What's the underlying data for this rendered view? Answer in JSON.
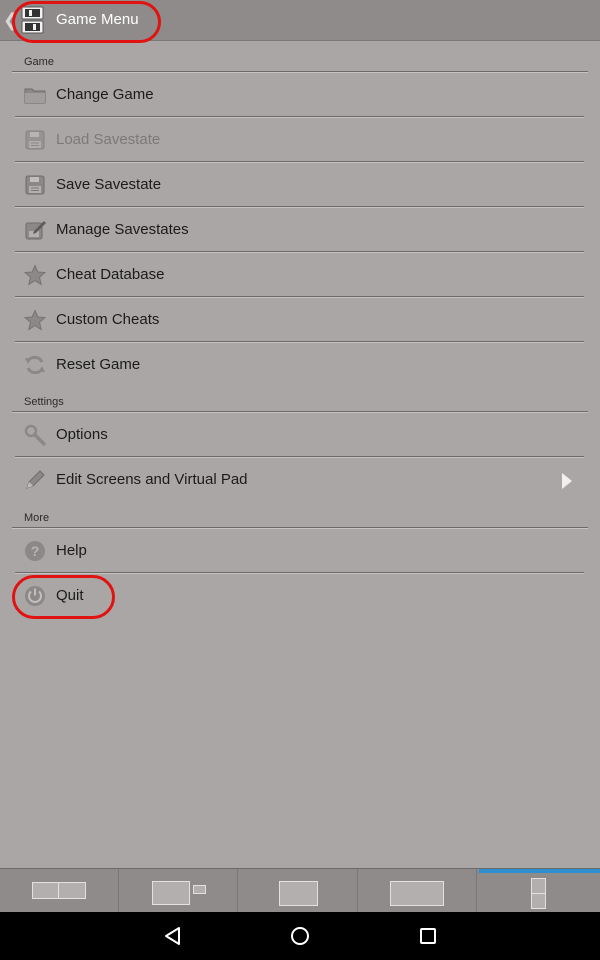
{
  "header": {
    "title": "Game Menu",
    "icon": "ds-logo-icon",
    "back_icon": "chevron-left-icon"
  },
  "sections": [
    {
      "title": "Game",
      "items": [
        {
          "label": "Change Game",
          "icon": "folder-icon",
          "enabled": true
        },
        {
          "label": "Load Savestate",
          "icon": "floppy-icon",
          "enabled": false
        },
        {
          "label": "Save Savestate",
          "icon": "floppy-icon",
          "enabled": true
        },
        {
          "label": "Manage Savestates",
          "icon": "edit-floppy-icon",
          "enabled": true
        },
        {
          "label": "Cheat Database",
          "icon": "star-icon",
          "enabled": true
        },
        {
          "label": "Custom Cheats",
          "icon": "star-icon",
          "enabled": true
        },
        {
          "label": "Reset Game",
          "icon": "refresh-icon",
          "enabled": true
        }
      ]
    },
    {
      "title": "Settings",
      "items": [
        {
          "label": "Options",
          "icon": "wrench-icon",
          "enabled": true
        },
        {
          "label": "Edit Screens and Virtual Pad",
          "icon": "pencil-icon",
          "enabled": true,
          "submenu": true
        }
      ]
    },
    {
      "title": "More",
      "items": [
        {
          "label": "Help",
          "icon": "help-icon",
          "enabled": true
        },
        {
          "label": "Quit",
          "icon": "power-icon",
          "enabled": true
        }
      ]
    }
  ],
  "layout_tabs": [
    {
      "name": "layout-side-by-side-icon",
      "active": false
    },
    {
      "name": "layout-main-with-mini-icon",
      "active": false
    },
    {
      "name": "layout-single-small-icon",
      "active": false
    },
    {
      "name": "layout-single-wide-icon",
      "active": false
    },
    {
      "name": "layout-stacked-icon",
      "active": true
    }
  ],
  "android_nav": {
    "back": "back-triangle-icon",
    "home": "home-circle-icon",
    "recents": "recents-square-icon"
  },
  "colors": {
    "background": "#aba6a6",
    "action_bar": "#8f8b8b",
    "highlight_ring": "#e01212",
    "active_tab": "#2e8fd0"
  }
}
